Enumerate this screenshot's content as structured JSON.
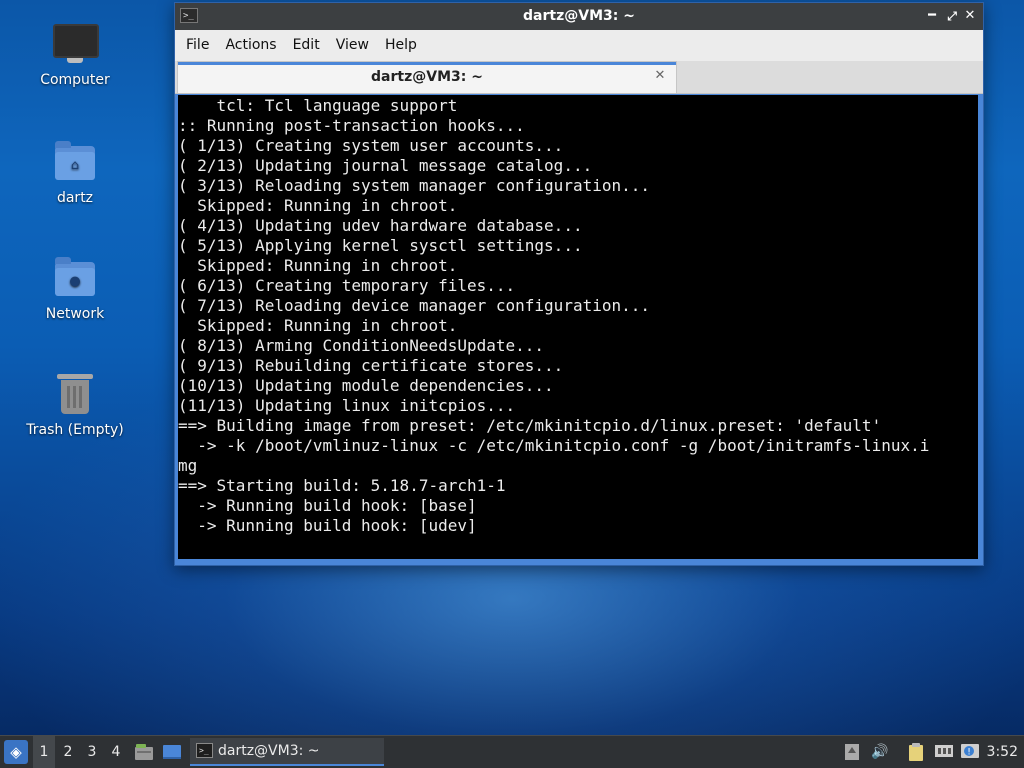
{
  "desktop": {
    "icons": [
      {
        "label": "Computer",
        "icon": "computer-icon"
      },
      {
        "label": "dartz",
        "icon": "home-folder-icon"
      },
      {
        "label": "Network",
        "icon": "network-folder-icon"
      },
      {
        "label": "Trash (Empty)",
        "icon": "trash-icon"
      }
    ]
  },
  "window": {
    "title": "dartz@VM3: ~",
    "controls": {
      "minimize": "━",
      "maximize": "⤢",
      "close": "✕"
    },
    "menu": [
      "File",
      "Actions",
      "Edit",
      "View",
      "Help"
    ],
    "tab": {
      "title": "dartz@VM3: ~",
      "close": "✕"
    },
    "terminal_lines": [
      "    tcl: Tcl language support",
      ":: Running post-transaction hooks...",
      "( 1/13) Creating system user accounts...",
      "( 2/13) Updating journal message catalog...",
      "( 3/13) Reloading system manager configuration...",
      "  Skipped: Running in chroot.",
      "( 4/13) Updating udev hardware database...",
      "( 5/13) Applying kernel sysctl settings...",
      "  Skipped: Running in chroot.",
      "( 6/13) Creating temporary files...",
      "( 7/13) Reloading device manager configuration...",
      "  Skipped: Running in chroot.",
      "( 8/13) Arming ConditionNeedsUpdate...",
      "( 9/13) Rebuilding certificate stores...",
      "(10/13) Updating module dependencies...",
      "(11/13) Updating linux initcpios...",
      "==> Building image from preset: /etc/mkinitcpio.d/linux.preset: 'default'",
      "  -> -k /boot/vmlinuz-linux -c /etc/mkinitcpio.conf -g /boot/initramfs-linux.i",
      "mg",
      "==> Starting build: 5.18.7-arch1-1",
      "  -> Running build hook: [base]",
      "  -> Running build hook: [udev]"
    ]
  },
  "taskbar": {
    "workspaces": [
      "1",
      "2",
      "3",
      "4"
    ],
    "active_workspace": "1",
    "task_label": "dartz@VM3: ~",
    "clock": "3:52",
    "accent_color": "#4a86d8"
  }
}
